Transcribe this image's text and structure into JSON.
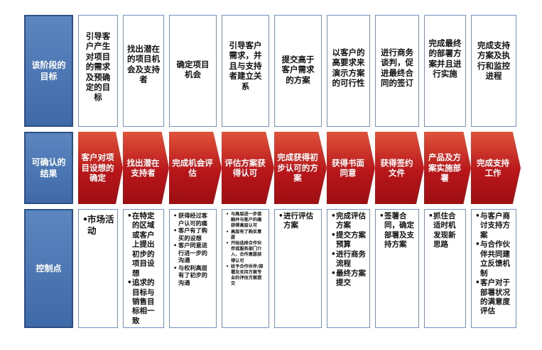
{
  "row_headers": {
    "goal": "该阶段的目标",
    "result": "可确认的结果",
    "control": "控制点"
  },
  "stages": [
    {
      "goal": "引导客户产生对项目的需求及预确定的目标",
      "result": "客户对项目设想的确定",
      "controls": [
        "市场活动"
      ]
    },
    {
      "goal": "找出潜在的项目机会及支持者",
      "result": "找出潜在支持者",
      "controls": [
        "在特定的区域或客户上提出初步的项目设想",
        "追求的目标与销售目标相一致"
      ]
    },
    {
      "goal": "确定项目机会",
      "result": "完成机会评估",
      "controls": [
        "获得经过客户认可的痛",
        "客户有了购买的设想",
        "客户同意进行进一步的沟通",
        "与权利高层有了初步的沟通"
      ]
    },
    {
      "goal": "引导客户需求，并且与支持者建立关系",
      "result": "评估方案获得认可",
      "controls": [
        "与高层进一步接触并与客户的痛获得高层认可",
        "高层有了购买意愿",
        "开始选择合作伙伴或服务部门介入，合作意愿获得认可",
        "给予合作伙伴/部署及支持方案专业的评估方案提交"
      ]
    },
    {
      "goal": "提交高于客户需求的方案",
      "result": "完成获得初步认可的方案",
      "controls": [
        "进行评估方案"
      ]
    },
    {
      "goal": "以客户的高要求来演示方案的可行性",
      "result": "获得书面同意",
      "controls": [
        "完成评估方案",
        "提交方案预算",
        "进行商务流程",
        "最终方案提交"
      ]
    },
    {
      "goal": "进行商务谈判，促进最终合同的签订",
      "result": "获得签约文件",
      "controls": [
        "签署合同，确定部署及支持方案"
      ]
    },
    {
      "goal": "完成最终的部署方案并且进行实施",
      "result": "产品及方案实施部署",
      "controls": [
        "抓住合适时机发现新思路"
      ]
    },
    {
      "goal": "完成支持方案及执行和监控进程",
      "result": "完成支持工作",
      "controls": [
        "与客户商讨支持方案",
        "与合作伙伴共同建立反馈机制",
        "客户对于部署状况的满意度评估"
      ]
    }
  ]
}
